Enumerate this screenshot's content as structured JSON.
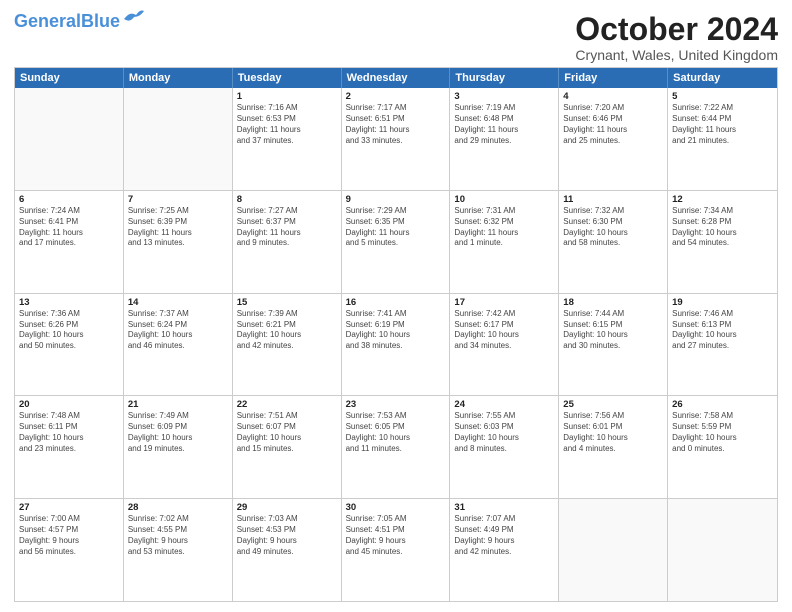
{
  "logo": {
    "line1": "General",
    "line2": "Blue"
  },
  "title": "October 2024",
  "location": "Crynant, Wales, United Kingdom",
  "days_of_week": [
    "Sunday",
    "Monday",
    "Tuesday",
    "Wednesday",
    "Thursday",
    "Friday",
    "Saturday"
  ],
  "weeks": [
    [
      {
        "day": "",
        "content": ""
      },
      {
        "day": "",
        "content": ""
      },
      {
        "day": "1",
        "content": "Sunrise: 7:16 AM\nSunset: 6:53 PM\nDaylight: 11 hours and 37 minutes."
      },
      {
        "day": "2",
        "content": "Sunrise: 7:17 AM\nSunset: 6:51 PM\nDaylight: 11 hours and 33 minutes."
      },
      {
        "day": "3",
        "content": "Sunrise: 7:19 AM\nSunset: 6:48 PM\nDaylight: 11 hours and 29 minutes."
      },
      {
        "day": "4",
        "content": "Sunrise: 7:20 AM\nSunset: 6:46 PM\nDaylight: 11 hours and 25 minutes."
      },
      {
        "day": "5",
        "content": "Sunrise: 7:22 AM\nSunset: 6:44 PM\nDaylight: 11 hours and 21 minutes."
      }
    ],
    [
      {
        "day": "6",
        "content": "Sunrise: 7:24 AM\nSunset: 6:41 PM\nDaylight: 11 hours and 17 minutes."
      },
      {
        "day": "7",
        "content": "Sunrise: 7:25 AM\nSunset: 6:39 PM\nDaylight: 11 hours and 13 minutes."
      },
      {
        "day": "8",
        "content": "Sunrise: 7:27 AM\nSunset: 6:37 PM\nDaylight: 11 hours and 9 minutes."
      },
      {
        "day": "9",
        "content": "Sunrise: 7:29 AM\nSunset: 6:35 PM\nDaylight: 11 hours and 5 minutes."
      },
      {
        "day": "10",
        "content": "Sunrise: 7:31 AM\nSunset: 6:32 PM\nDaylight: 11 hours and 1 minute."
      },
      {
        "day": "11",
        "content": "Sunrise: 7:32 AM\nSunset: 6:30 PM\nDaylight: 10 hours and 58 minutes."
      },
      {
        "day": "12",
        "content": "Sunrise: 7:34 AM\nSunset: 6:28 PM\nDaylight: 10 hours and 54 minutes."
      }
    ],
    [
      {
        "day": "13",
        "content": "Sunrise: 7:36 AM\nSunset: 6:26 PM\nDaylight: 10 hours and 50 minutes."
      },
      {
        "day": "14",
        "content": "Sunrise: 7:37 AM\nSunset: 6:24 PM\nDaylight: 10 hours and 46 minutes."
      },
      {
        "day": "15",
        "content": "Sunrise: 7:39 AM\nSunset: 6:21 PM\nDaylight: 10 hours and 42 minutes."
      },
      {
        "day": "16",
        "content": "Sunrise: 7:41 AM\nSunset: 6:19 PM\nDaylight: 10 hours and 38 minutes."
      },
      {
        "day": "17",
        "content": "Sunrise: 7:42 AM\nSunset: 6:17 PM\nDaylight: 10 hours and 34 minutes."
      },
      {
        "day": "18",
        "content": "Sunrise: 7:44 AM\nSunset: 6:15 PM\nDaylight: 10 hours and 30 minutes."
      },
      {
        "day": "19",
        "content": "Sunrise: 7:46 AM\nSunset: 6:13 PM\nDaylight: 10 hours and 27 minutes."
      }
    ],
    [
      {
        "day": "20",
        "content": "Sunrise: 7:48 AM\nSunset: 6:11 PM\nDaylight: 10 hours and 23 minutes."
      },
      {
        "day": "21",
        "content": "Sunrise: 7:49 AM\nSunset: 6:09 PM\nDaylight: 10 hours and 19 minutes."
      },
      {
        "day": "22",
        "content": "Sunrise: 7:51 AM\nSunset: 6:07 PM\nDaylight: 10 hours and 15 minutes."
      },
      {
        "day": "23",
        "content": "Sunrise: 7:53 AM\nSunset: 6:05 PM\nDaylight: 10 hours and 11 minutes."
      },
      {
        "day": "24",
        "content": "Sunrise: 7:55 AM\nSunset: 6:03 PM\nDaylight: 10 hours and 8 minutes."
      },
      {
        "day": "25",
        "content": "Sunrise: 7:56 AM\nSunset: 6:01 PM\nDaylight: 10 hours and 4 minutes."
      },
      {
        "day": "26",
        "content": "Sunrise: 7:58 AM\nSunset: 5:59 PM\nDaylight: 10 hours and 0 minutes."
      }
    ],
    [
      {
        "day": "27",
        "content": "Sunrise: 7:00 AM\nSunset: 4:57 PM\nDaylight: 9 hours and 56 minutes."
      },
      {
        "day": "28",
        "content": "Sunrise: 7:02 AM\nSunset: 4:55 PM\nDaylight: 9 hours and 53 minutes."
      },
      {
        "day": "29",
        "content": "Sunrise: 7:03 AM\nSunset: 4:53 PM\nDaylight: 9 hours and 49 minutes."
      },
      {
        "day": "30",
        "content": "Sunrise: 7:05 AM\nSunset: 4:51 PM\nDaylight: 9 hours and 45 minutes."
      },
      {
        "day": "31",
        "content": "Sunrise: 7:07 AM\nSunset: 4:49 PM\nDaylight: 9 hours and 42 minutes."
      },
      {
        "day": "",
        "content": ""
      },
      {
        "day": "",
        "content": ""
      }
    ]
  ]
}
